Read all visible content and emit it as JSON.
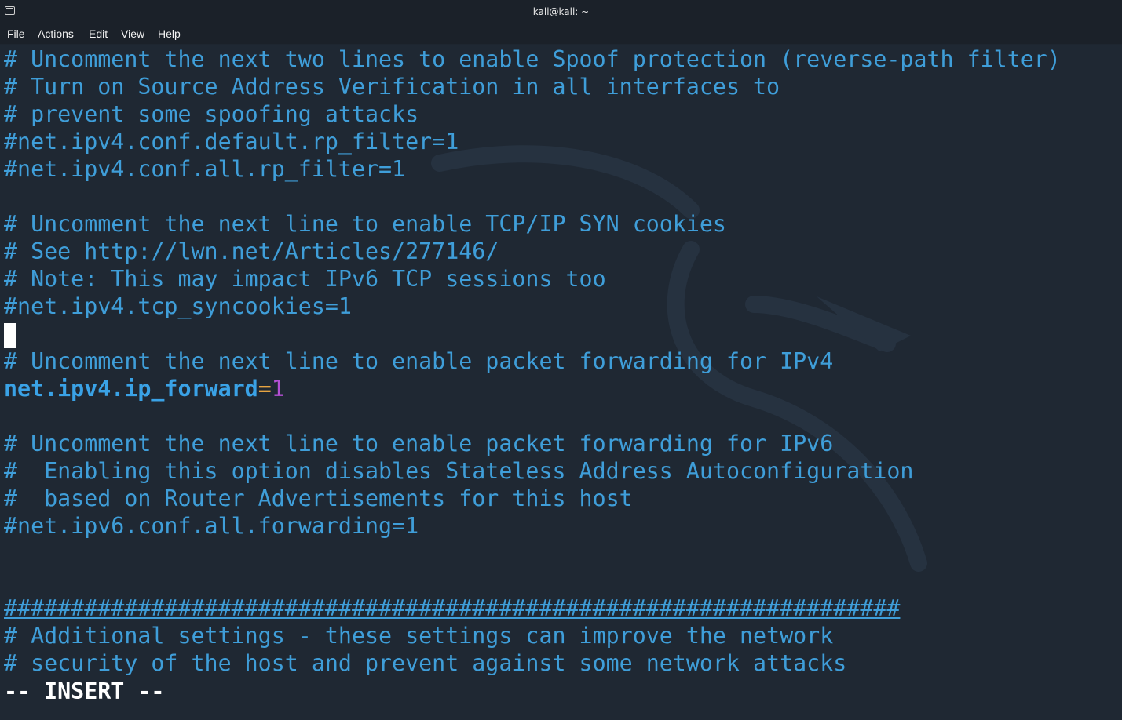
{
  "window": {
    "title": "kali@kali: ~"
  },
  "menu": {
    "items": [
      "File",
      "Actions",
      "Edit",
      "View",
      "Help"
    ]
  },
  "editor": {
    "lines": [
      "# Uncomment the next two lines to enable Spoof protection (reverse-path filter)",
      "# Turn on Source Address Verification in all interfaces to",
      "# prevent some spoofing attacks",
      "#net.ipv4.conf.default.rp_filter=1",
      "#net.ipv4.conf.all.rp_filter=1",
      "",
      "# Uncomment the next line to enable TCP/IP SYN cookies",
      "# See http://lwn.net/Articles/277146/",
      "# Note: This may impact IPv6 TCP sessions too",
      "#net.ipv4.tcp_syncookies=1",
      "",
      "# Uncomment the next line to enable packet forwarding for IPv4",
      "",
      "",
      "# Uncomment the next line to enable packet forwarding for IPv6",
      "#  Enabling this option disables Stateless Address Autoconfiguration",
      "#  based on Router Advertisements for this host",
      "#net.ipv6.conf.all.forwarding=1",
      "",
      "",
      "###################################################################",
      "# Additional settings - these settings can improve the network",
      "# security of the host and prevent against some network attacks"
    ],
    "active_setting": {
      "key": "net.ipv4.ip_forward",
      "eq": "=",
      "value": "1"
    },
    "mode": "-- INSERT --"
  },
  "colors": {
    "comment": "#3f9ed9",
    "key": "#3aa2e6",
    "equals": "#e6a442",
    "value": "#b44fd4",
    "background": "#1f2833"
  }
}
